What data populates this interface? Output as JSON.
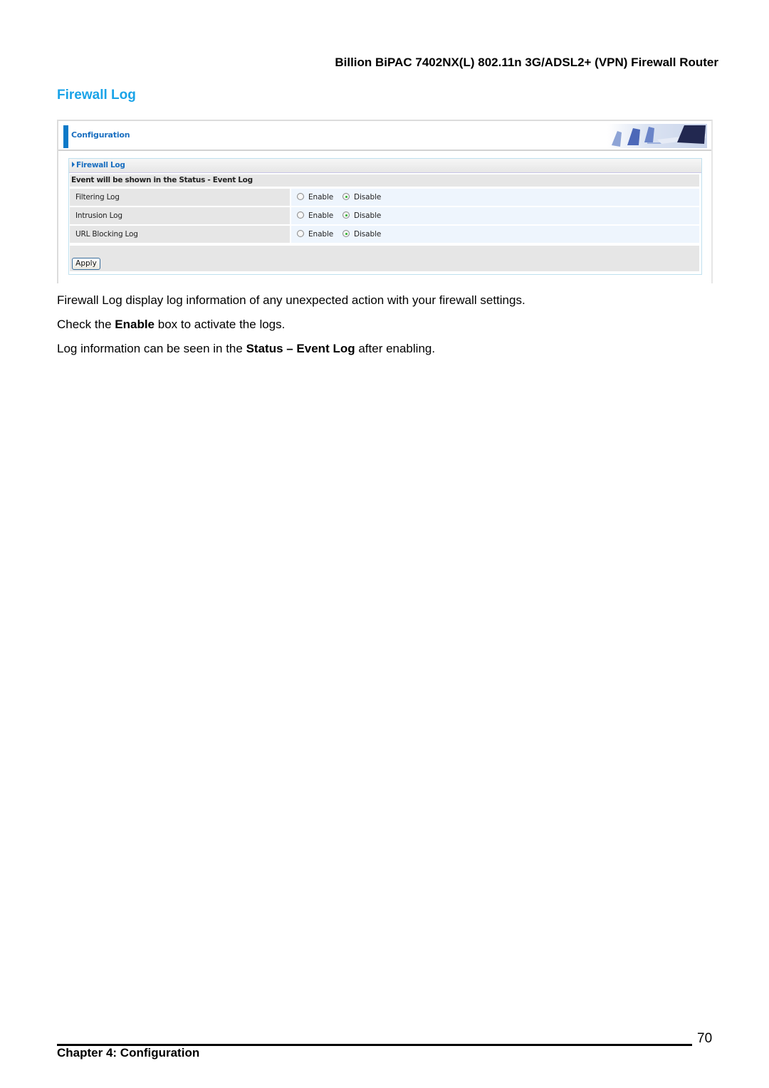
{
  "header": {
    "product_title": "Billion BiPAC 7402NX(L) 802.11n 3G/ADSL2+ (VPN) Firewall Router"
  },
  "section": {
    "title": "Firewall Log"
  },
  "screenshot": {
    "top_label": "Configuration",
    "panel_title": "Firewall Log",
    "event_note": "Event will be shown in the Status - Event Log",
    "rows": [
      {
        "label": "Filtering Log",
        "enable_label": "Enable",
        "disable_label": "Disable",
        "selected": "Disable"
      },
      {
        "label": "Intrusion Log",
        "enable_label": "Enable",
        "disable_label": "Disable",
        "selected": "Disable"
      },
      {
        "label": "URL Blocking Log",
        "enable_label": "Enable",
        "disable_label": "Disable",
        "selected": "Disable"
      }
    ],
    "apply_label": "Apply",
    "colors": {
      "accent_blue": "#1a6fc0",
      "bar_blue": "#0a79c8",
      "radio_selected": "#2ab12a"
    }
  },
  "body": {
    "p1": "Firewall Log display log information of any unexpected action with your firewall settings.",
    "p2_pre": "Check the ",
    "p2_bold": "Enable",
    "p2_post": " box to activate the logs.",
    "p3_pre": "Log information can be seen in the ",
    "p3_bold": "Status – Event Log",
    "p3_post": " after enabling."
  },
  "footer": {
    "chapter": "Chapter 4: Configuration",
    "page_number": "70"
  },
  "colors": {
    "section_title": "#1aa3e8"
  }
}
